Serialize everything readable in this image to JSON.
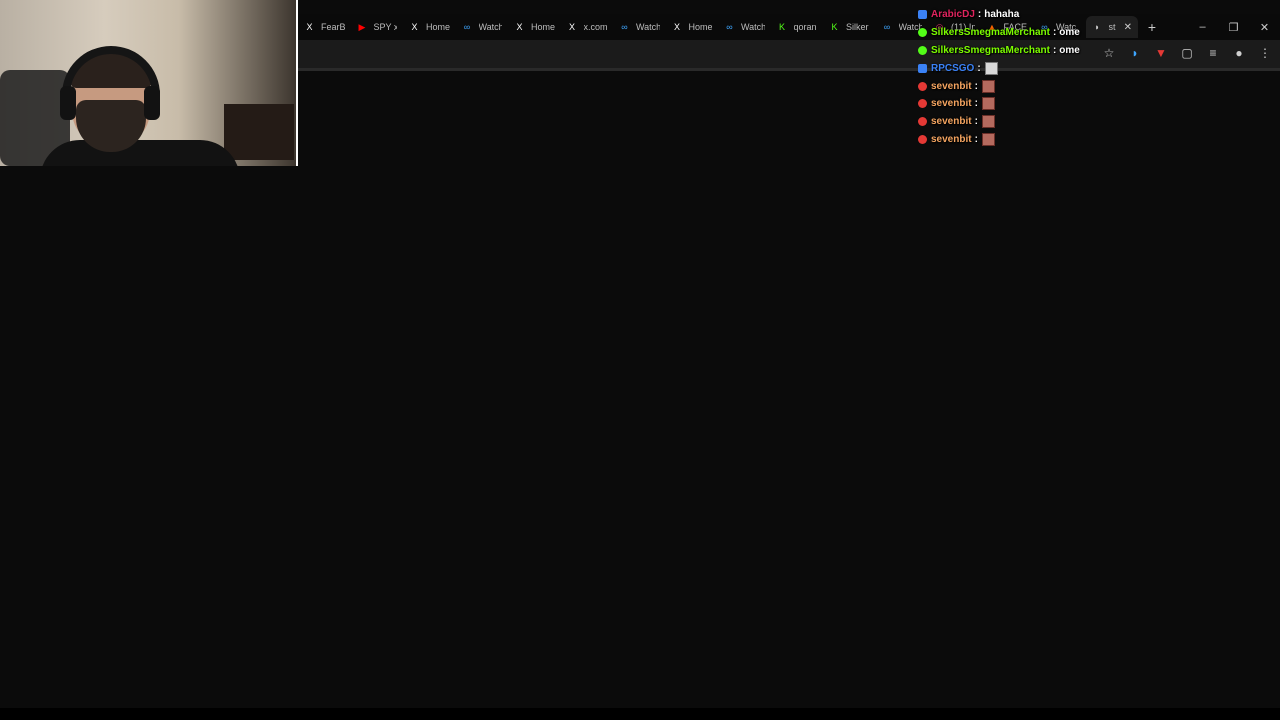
{
  "browser": {
    "tabs": [
      {
        "label": "FearB",
        "icon": "x-logo-icon",
        "color": "#ffffff"
      },
      {
        "label": "SPY x",
        "icon": "youtube-icon",
        "color": "#ff0000"
      },
      {
        "label": "Home",
        "icon": "x-logo-icon",
        "color": "#ffffff"
      },
      {
        "label": "Watch",
        "icon": "watch-icon",
        "color": "#3ea6ff"
      },
      {
        "label": "Home",
        "icon": "x-logo-icon",
        "color": "#ffffff"
      },
      {
        "label": "x.com",
        "icon": "x-logo-icon",
        "color": "#ffffff"
      },
      {
        "label": "Watch",
        "icon": "watch-icon",
        "color": "#3ea6ff"
      },
      {
        "label": "Home",
        "icon": "x-logo-icon",
        "color": "#ffffff"
      },
      {
        "label": "Watch",
        "icon": "watch-icon",
        "color": "#3ea6ff"
      },
      {
        "label": "qoran",
        "icon": "kick-icon",
        "color": "#53fc18"
      },
      {
        "label": "Silker",
        "icon": "kick-icon",
        "color": "#53fc18"
      },
      {
        "label": "Watch",
        "icon": "watch-icon",
        "color": "#3ea6ff"
      },
      {
        "label": "(11) In",
        "icon": "instagram-icon",
        "color": "#e1306c"
      },
      {
        "label": "FACE",
        "icon": "face-icon",
        "color": "#ff6600"
      },
      {
        "label": "Watc",
        "icon": "watch-icon",
        "color": "#3ea6ff"
      },
      {
        "label": "st",
        "icon": "audio-icon",
        "color": "#cccccc",
        "active": true
      }
    ],
    "new_tab": "+",
    "window_controls": {
      "minimize": "–",
      "restore": "❐",
      "close": "✕"
    },
    "toolbar_icons": [
      "star-icon",
      "audio-icon",
      "extension-red-icon",
      "puzzle-icon",
      "media-icon",
      "profile-icon",
      "menu-icon"
    ]
  },
  "chat": {
    "messages": [
      {
        "user": "ArabicDJ",
        "text": "hahaha",
        "color": "#e0245e",
        "badge": "mod",
        "emote": false
      },
      {
        "user": "SilkersSmegmaMerchant",
        "text": "ome",
        "color": "#7cfc00",
        "badge": "green",
        "emote": false
      },
      {
        "user": "SilkersSmegmaMerchant",
        "text": "ome",
        "color": "#7cfc00",
        "badge": "green",
        "emote": false
      },
      {
        "user": "RPCSGO",
        "text": "",
        "color": "#3b82f6",
        "badge": "mod",
        "emote": "gray"
      },
      {
        "user": "sevenbit",
        "text": "",
        "color": "#f4a460",
        "badge": "red",
        "emote": "red"
      },
      {
        "user": "sevenbit",
        "text": "",
        "color": "#f4a460",
        "badge": "red",
        "emote": "red"
      },
      {
        "user": "sevenbit",
        "text": "",
        "color": "#f4a460",
        "badge": "red",
        "emote": "red"
      },
      {
        "user": "sevenbit",
        "text": "",
        "color": "#f4a460",
        "badge": "red",
        "emote": "red"
      }
    ]
  }
}
